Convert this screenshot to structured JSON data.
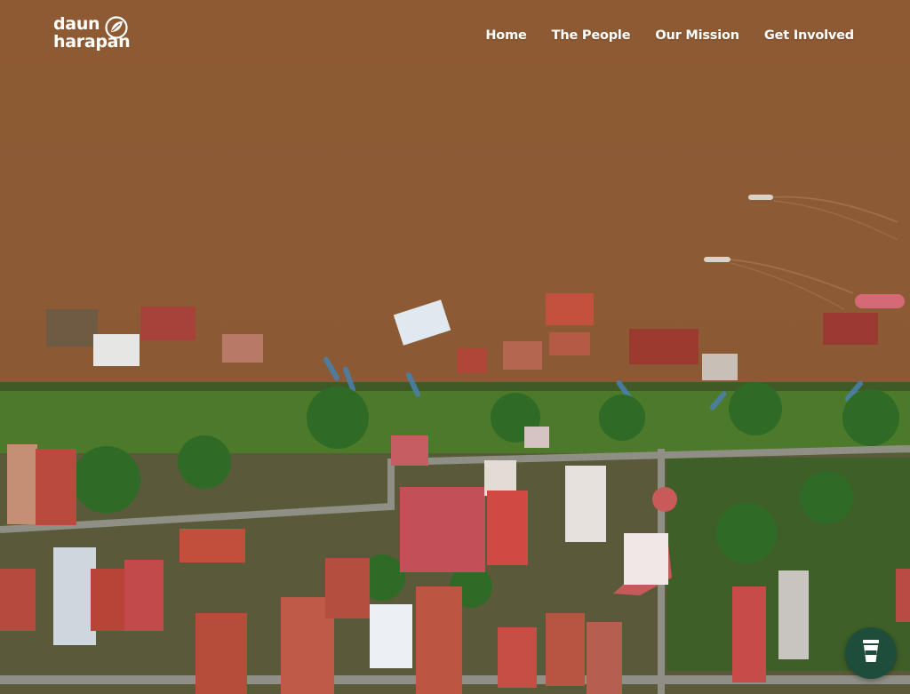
{
  "brand": {
    "line1": "daun",
    "line2": "harapan",
    "icon": "leaf-circle-icon"
  },
  "nav": {
    "items": [
      {
        "label": "Home"
      },
      {
        "label": "The People"
      },
      {
        "label": "Our Mission"
      },
      {
        "label": "Get Involved"
      }
    ]
  },
  "hero": {
    "image": "aerial-river-village"
  },
  "fab": {
    "icon": "coffee-cup-icon",
    "color": "#1f4d3c"
  }
}
